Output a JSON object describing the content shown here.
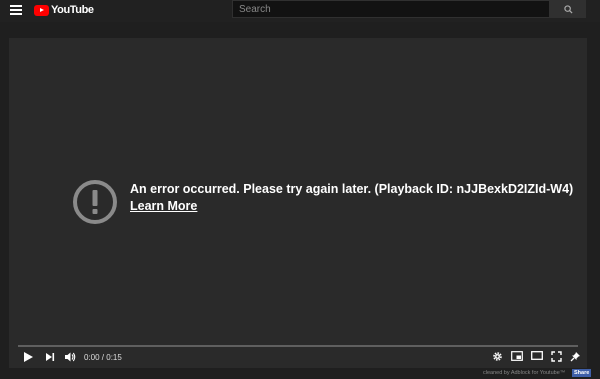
{
  "header": {
    "logo_text": "YouTube",
    "search_placeholder": "Search"
  },
  "player": {
    "error_message": "An error occurred. Please try again later. (Playback ID: nJJBexkD2IZId-W4)",
    "learn_more": "Learn More",
    "time_current": "0:00",
    "time_separator": " / ",
    "time_total": "0:15"
  },
  "footer": {
    "note": "cleaned by Adblock for Youtube™",
    "share_label": "Share"
  },
  "colors": {
    "brand_red": "#ff0000",
    "share_blue": "#3f5fa8"
  },
  "icons": [
    "menu-icon",
    "search-icon",
    "error-icon",
    "play-icon",
    "next-icon",
    "volume-icon",
    "settings-icon",
    "miniplayer-icon",
    "theater-icon",
    "fullscreen-icon",
    "pin-icon"
  ]
}
